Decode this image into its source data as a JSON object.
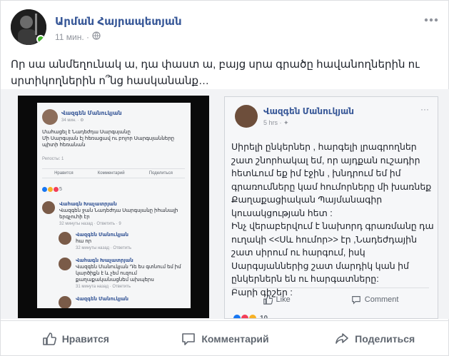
{
  "post": {
    "author": "Արման Հայրապետյան",
    "time": "11 мин. ·",
    "more_icon": "more-dots-icon",
    "text": "Որ սա անմեղունակ ա, դա փաստ ա, բայց սրա գրածը հավանողներին ու սրտիկողներին ո՞նց հասկանանք…"
  },
  "left_image": {
    "author": "Վազգեն Մանուկյան",
    "time": "34 мин. · ⚙",
    "text": "Մահացել է Նադեժդա Սարգսյանը\nՄի Սարգսյան էլ հեռացավ ու բոլոր Սարգսյանները պիտի հեռանան",
    "reposts": "Репосты: 1",
    "like": "Нравится",
    "comment": "Комментарий",
    "share": "Поделиться",
    "reaction_count": "5",
    "comments": [
      {
        "name": "Վահագն Խաչատրյան",
        "text": "Վազգեն ջան Նադեժդա Սարգսյանը իհանալի երգչուհի էր",
        "meta": "32 минуты назад · Ответить · 9"
      },
      {
        "name": "Վազգեն Մանուկյան",
        "text": "հա որ",
        "meta": "32 минуты назад · Ответить"
      },
      {
        "name": "Վահագն Խաչատրյան",
        "text": "Վազգեն Մանուկյան Դե ես գտնում եմ իմ կարծիքն է և չեմ ուզում քաղաքականացնեմ ախպերս",
        "meta": "31 минута назад · Ответить"
      },
      {
        "name": "Վազգեն Մանուկյան",
        "text": "",
        "meta": ""
      }
    ]
  },
  "right_image": {
    "author": "Վազգեն Մանուկյան",
    "time": "5 hrs · ✦",
    "more": "···",
    "text": "Սիրելի ընկերներ , հարգելի լրագրողներ շատ շնորհակալ եմ, որ այդքան ուշադիր հետևում եք իմ էջին , խնդրում եմ իմ գրառումները կամ հումորները մի խառնեք Քաղաքացիական Պայմանագիր կուսակցության հետ :\nԻնչ վերաբերվում է նախորդ գրառմանը դա ուղակի <<Սև հումոր>> էր ,Նադեժդային շատ սիրում ու հարգում, իսկ Սարգսյաններից շատ մարդիկ կան իմ ընկերներն են ու հարգատները:\nԲարի գիշեր :",
    "like": "Like",
    "comment": "Comment",
    "reaction_count": "10"
  },
  "actions": {
    "like": "Нравится",
    "comment": "Комментарий",
    "share": "Поделиться"
  },
  "colors": {
    "link": "#385898",
    "muted": "#90949c",
    "online": "#42b72a"
  }
}
